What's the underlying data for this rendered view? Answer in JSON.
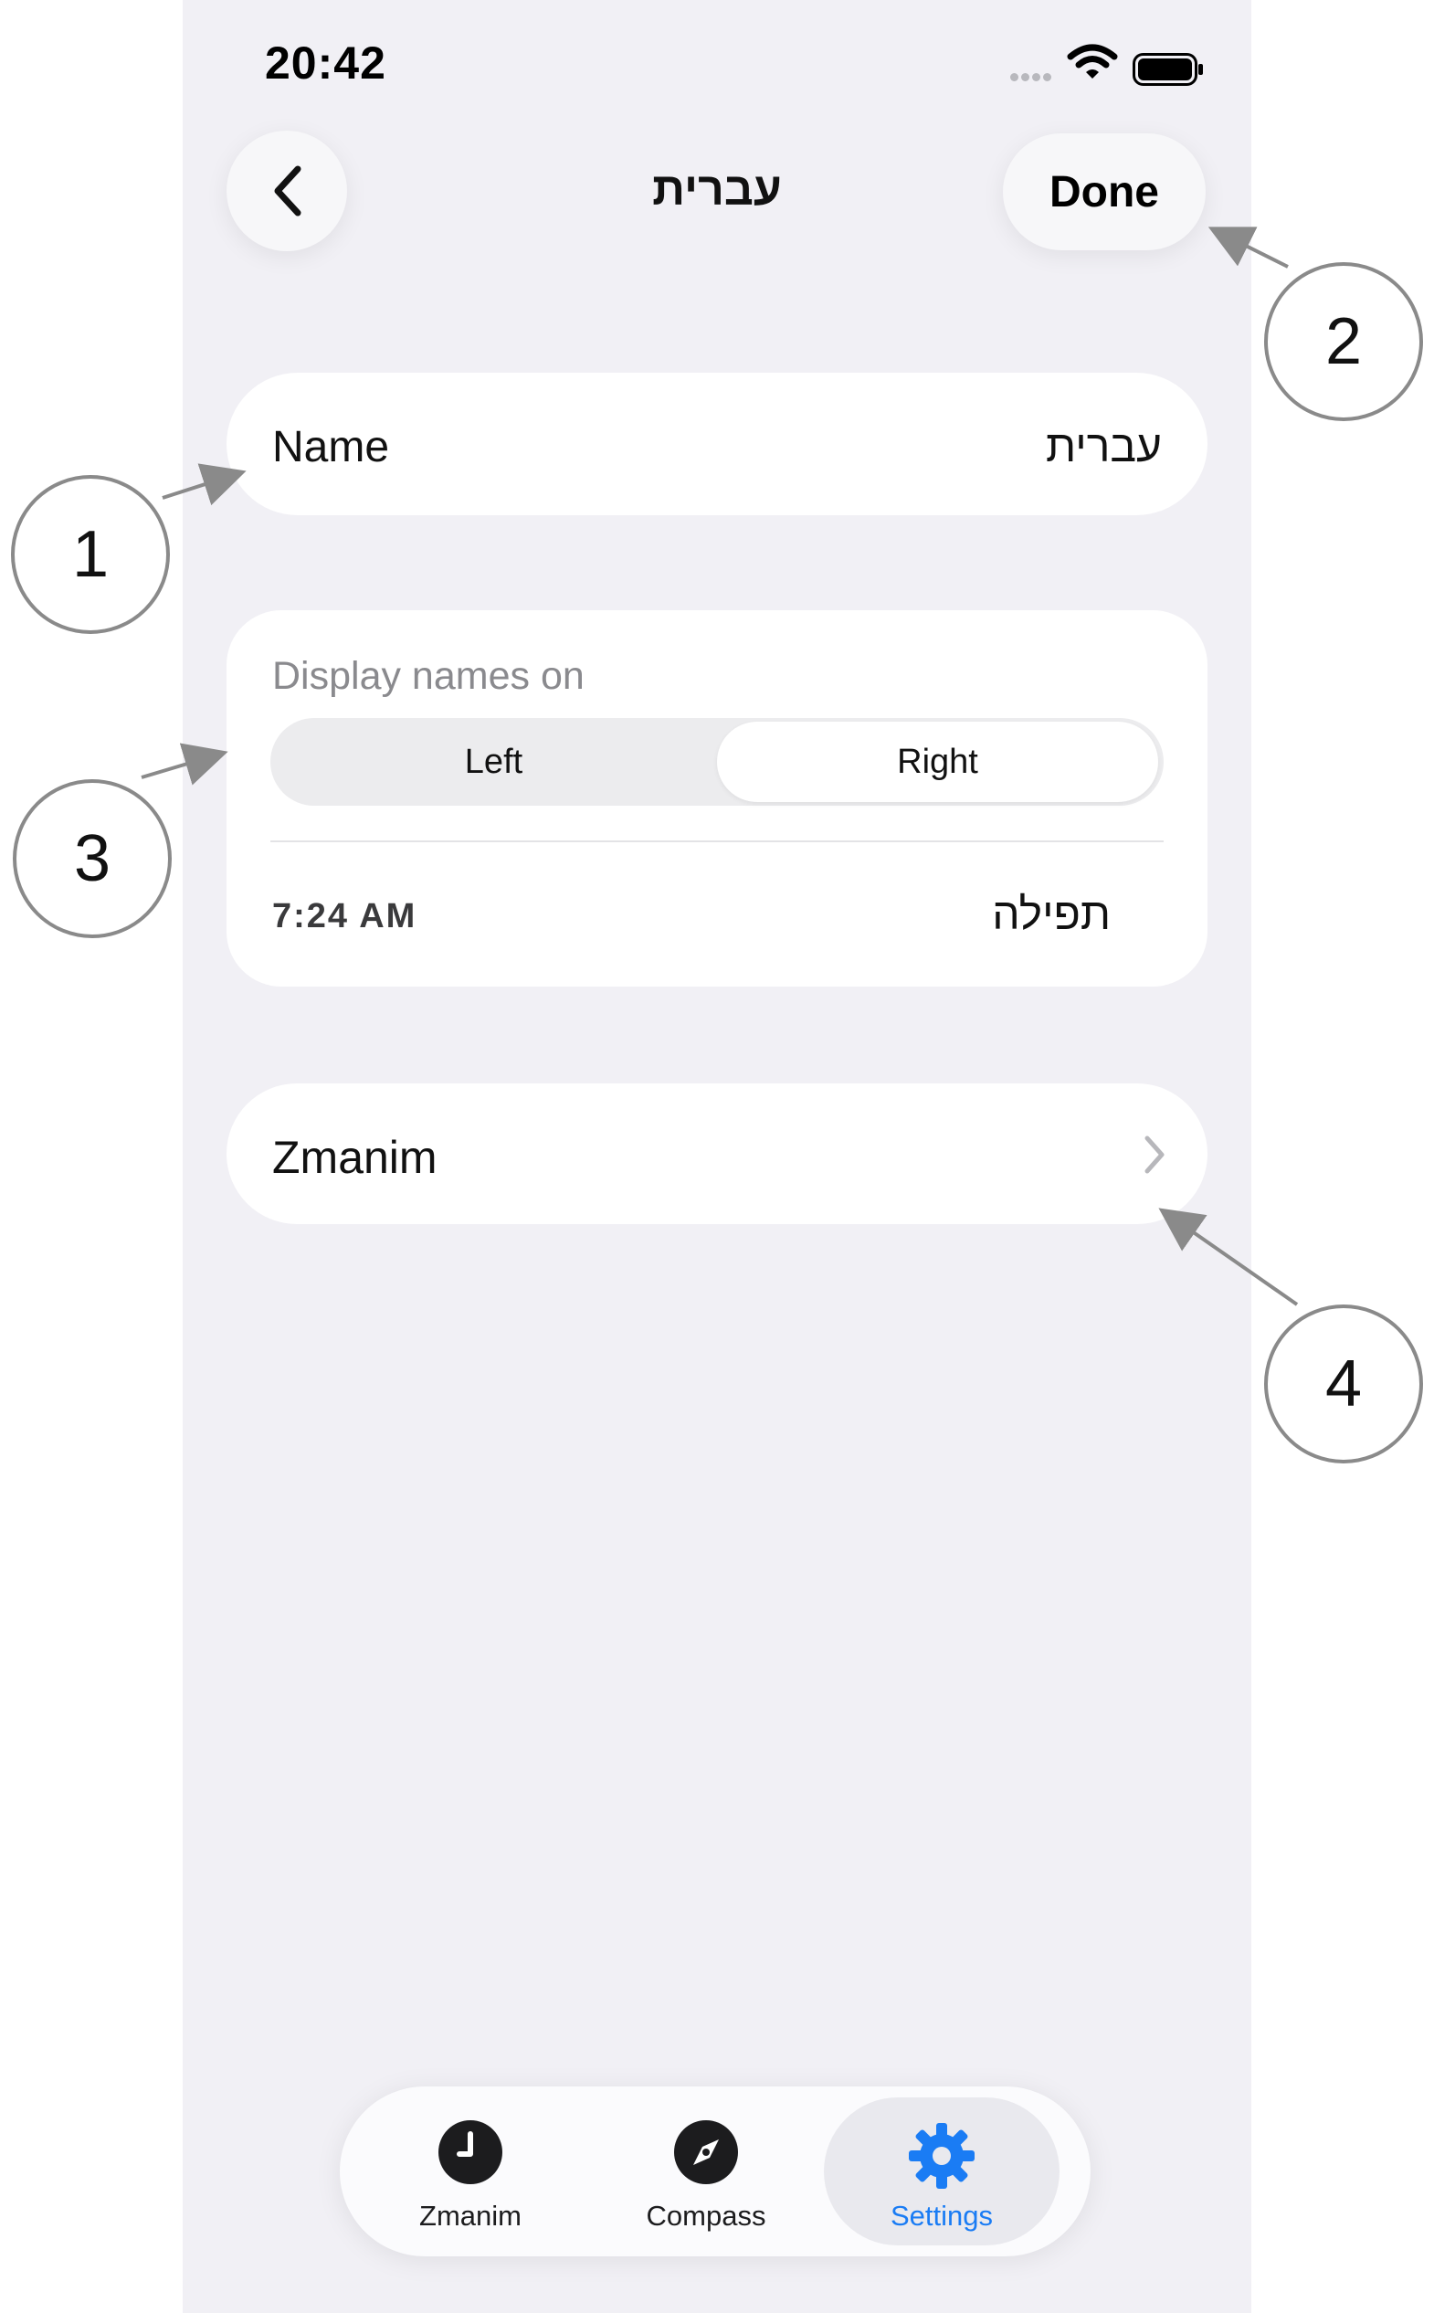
{
  "status_bar": {
    "time": "20:42"
  },
  "nav": {
    "back_icon": "chevron-left-icon",
    "title": "עברית",
    "done_label": "Done"
  },
  "name_row": {
    "label": "Name",
    "value": "עברית"
  },
  "display_section": {
    "label": "Display names on",
    "options": [
      "Left",
      "Right"
    ],
    "selected": "Right",
    "example_time": "7:24 AM",
    "example_name": "תפילה"
  },
  "zmanim_row": {
    "label": "Zmanim",
    "icon": "chevron-right-icon"
  },
  "tabbar": {
    "tabs": [
      {
        "label": "Zmanim",
        "icon": "clock-icon"
      },
      {
        "label": "Compass",
        "icon": "compass-icon"
      },
      {
        "label": "Settings",
        "icon": "gear-icon",
        "active": true
      }
    ],
    "active_color": "#1a7cf4"
  },
  "callouts": [
    "1",
    "2",
    "3",
    "4"
  ]
}
